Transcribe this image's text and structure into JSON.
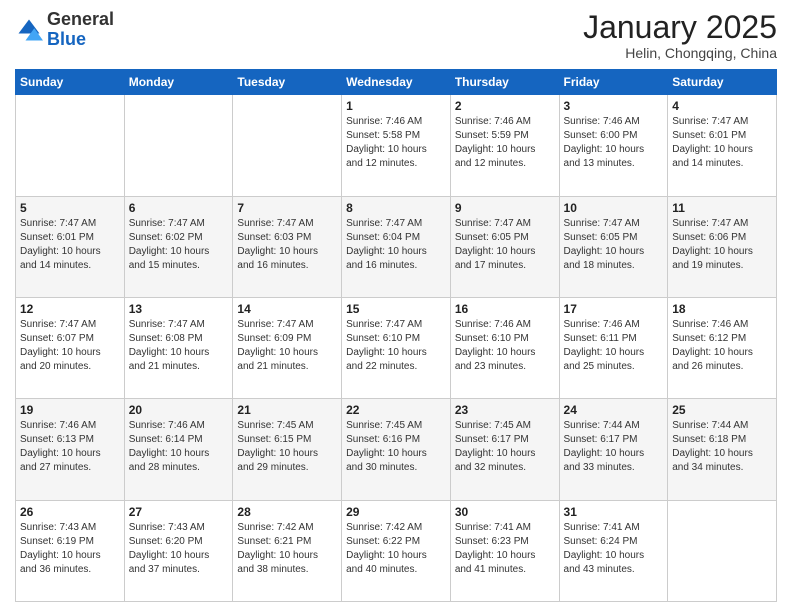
{
  "logo": {
    "general": "General",
    "blue": "Blue"
  },
  "header": {
    "title": "January 2025",
    "subtitle": "Helin, Chongqing, China"
  },
  "days_of_week": [
    "Sunday",
    "Monday",
    "Tuesday",
    "Wednesday",
    "Thursday",
    "Friday",
    "Saturday"
  ],
  "weeks": [
    [
      {
        "day": "",
        "sunrise": "",
        "sunset": "",
        "daylight": ""
      },
      {
        "day": "",
        "sunrise": "",
        "sunset": "",
        "daylight": ""
      },
      {
        "day": "",
        "sunrise": "",
        "sunset": "",
        "daylight": ""
      },
      {
        "day": "1",
        "sunrise": "Sunrise: 7:46 AM",
        "sunset": "Sunset: 5:58 PM",
        "daylight": "Daylight: 10 hours and 12 minutes."
      },
      {
        "day": "2",
        "sunrise": "Sunrise: 7:46 AM",
        "sunset": "Sunset: 5:59 PM",
        "daylight": "Daylight: 10 hours and 12 minutes."
      },
      {
        "day": "3",
        "sunrise": "Sunrise: 7:46 AM",
        "sunset": "Sunset: 6:00 PM",
        "daylight": "Daylight: 10 hours and 13 minutes."
      },
      {
        "day": "4",
        "sunrise": "Sunrise: 7:47 AM",
        "sunset": "Sunset: 6:01 PM",
        "daylight": "Daylight: 10 hours and 14 minutes."
      }
    ],
    [
      {
        "day": "5",
        "sunrise": "Sunrise: 7:47 AM",
        "sunset": "Sunset: 6:01 PM",
        "daylight": "Daylight: 10 hours and 14 minutes."
      },
      {
        "day": "6",
        "sunrise": "Sunrise: 7:47 AM",
        "sunset": "Sunset: 6:02 PM",
        "daylight": "Daylight: 10 hours and 15 minutes."
      },
      {
        "day": "7",
        "sunrise": "Sunrise: 7:47 AM",
        "sunset": "Sunset: 6:03 PM",
        "daylight": "Daylight: 10 hours and 16 minutes."
      },
      {
        "day": "8",
        "sunrise": "Sunrise: 7:47 AM",
        "sunset": "Sunset: 6:04 PM",
        "daylight": "Daylight: 10 hours and 16 minutes."
      },
      {
        "day": "9",
        "sunrise": "Sunrise: 7:47 AM",
        "sunset": "Sunset: 6:05 PM",
        "daylight": "Daylight: 10 hours and 17 minutes."
      },
      {
        "day": "10",
        "sunrise": "Sunrise: 7:47 AM",
        "sunset": "Sunset: 6:05 PM",
        "daylight": "Daylight: 10 hours and 18 minutes."
      },
      {
        "day": "11",
        "sunrise": "Sunrise: 7:47 AM",
        "sunset": "Sunset: 6:06 PM",
        "daylight": "Daylight: 10 hours and 19 minutes."
      }
    ],
    [
      {
        "day": "12",
        "sunrise": "Sunrise: 7:47 AM",
        "sunset": "Sunset: 6:07 PM",
        "daylight": "Daylight: 10 hours and 20 minutes."
      },
      {
        "day": "13",
        "sunrise": "Sunrise: 7:47 AM",
        "sunset": "Sunset: 6:08 PM",
        "daylight": "Daylight: 10 hours and 21 minutes."
      },
      {
        "day": "14",
        "sunrise": "Sunrise: 7:47 AM",
        "sunset": "Sunset: 6:09 PM",
        "daylight": "Daylight: 10 hours and 21 minutes."
      },
      {
        "day": "15",
        "sunrise": "Sunrise: 7:47 AM",
        "sunset": "Sunset: 6:10 PM",
        "daylight": "Daylight: 10 hours and 22 minutes."
      },
      {
        "day": "16",
        "sunrise": "Sunrise: 7:46 AM",
        "sunset": "Sunset: 6:10 PM",
        "daylight": "Daylight: 10 hours and 23 minutes."
      },
      {
        "day": "17",
        "sunrise": "Sunrise: 7:46 AM",
        "sunset": "Sunset: 6:11 PM",
        "daylight": "Daylight: 10 hours and 25 minutes."
      },
      {
        "day": "18",
        "sunrise": "Sunrise: 7:46 AM",
        "sunset": "Sunset: 6:12 PM",
        "daylight": "Daylight: 10 hours and 26 minutes."
      }
    ],
    [
      {
        "day": "19",
        "sunrise": "Sunrise: 7:46 AM",
        "sunset": "Sunset: 6:13 PM",
        "daylight": "Daylight: 10 hours and 27 minutes."
      },
      {
        "day": "20",
        "sunrise": "Sunrise: 7:46 AM",
        "sunset": "Sunset: 6:14 PM",
        "daylight": "Daylight: 10 hours and 28 minutes."
      },
      {
        "day": "21",
        "sunrise": "Sunrise: 7:45 AM",
        "sunset": "Sunset: 6:15 PM",
        "daylight": "Daylight: 10 hours and 29 minutes."
      },
      {
        "day": "22",
        "sunrise": "Sunrise: 7:45 AM",
        "sunset": "Sunset: 6:16 PM",
        "daylight": "Daylight: 10 hours and 30 minutes."
      },
      {
        "day": "23",
        "sunrise": "Sunrise: 7:45 AM",
        "sunset": "Sunset: 6:17 PM",
        "daylight": "Daylight: 10 hours and 32 minutes."
      },
      {
        "day": "24",
        "sunrise": "Sunrise: 7:44 AM",
        "sunset": "Sunset: 6:17 PM",
        "daylight": "Daylight: 10 hours and 33 minutes."
      },
      {
        "day": "25",
        "sunrise": "Sunrise: 7:44 AM",
        "sunset": "Sunset: 6:18 PM",
        "daylight": "Daylight: 10 hours and 34 minutes."
      }
    ],
    [
      {
        "day": "26",
        "sunrise": "Sunrise: 7:43 AM",
        "sunset": "Sunset: 6:19 PM",
        "daylight": "Daylight: 10 hours and 36 minutes."
      },
      {
        "day": "27",
        "sunrise": "Sunrise: 7:43 AM",
        "sunset": "Sunset: 6:20 PM",
        "daylight": "Daylight: 10 hours and 37 minutes."
      },
      {
        "day": "28",
        "sunrise": "Sunrise: 7:42 AM",
        "sunset": "Sunset: 6:21 PM",
        "daylight": "Daylight: 10 hours and 38 minutes."
      },
      {
        "day": "29",
        "sunrise": "Sunrise: 7:42 AM",
        "sunset": "Sunset: 6:22 PM",
        "daylight": "Daylight: 10 hours and 40 minutes."
      },
      {
        "day": "30",
        "sunrise": "Sunrise: 7:41 AM",
        "sunset": "Sunset: 6:23 PM",
        "daylight": "Daylight: 10 hours and 41 minutes."
      },
      {
        "day": "31",
        "sunrise": "Sunrise: 7:41 AM",
        "sunset": "Sunset: 6:24 PM",
        "daylight": "Daylight: 10 hours and 43 minutes."
      },
      {
        "day": "",
        "sunrise": "",
        "sunset": "",
        "daylight": ""
      }
    ]
  ]
}
